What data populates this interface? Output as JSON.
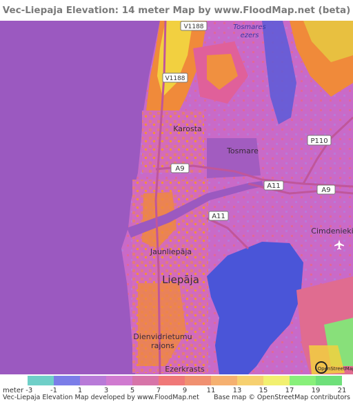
{
  "title": "Vec-Liepaja Elevation: 14 meter Map by www.FloodMap.net (beta)",
  "map": {
    "place_labels": {
      "karosta": "Karosta",
      "tosmare": "Tosmare",
      "tosmares_ezers_line1": "Tosmares",
      "tosmares_ezers_line2": "ezers",
      "jaunliepaja": "Jaunliepāja",
      "liepaja": "Liepāja",
      "cimdenieki": "Cimdenieki",
      "dienvidrietumu_line1": "Dienvidrietumu",
      "dienvidrietumu_line2": "rajons",
      "ezerkrasts": "Ezerkrasts"
    },
    "road_shields": {
      "v1188_top": "V1188",
      "v1188_mid": "V1188",
      "p110": "P110",
      "a9_west": "A9",
      "a11_mid": "A11",
      "a9_east": "A9",
      "a11_south": "A11"
    },
    "osm_badge": "OpenStreetMap",
    "airport_icon": "airplane-icon",
    "colors": {
      "sea": "#9b59c0",
      "lake": "#4a55d8",
      "land_low": "#d070c8",
      "land_mid": "#e0609a",
      "land_high": "#f08a3a",
      "land_peak": "#f2d040",
      "road": "#c0569a"
    }
  },
  "legend": {
    "unit_label": "meter",
    "ticks": [
      "-3",
      "-1",
      "1",
      "3",
      "5",
      "7",
      "9",
      "11",
      "13",
      "15",
      "17",
      "19",
      "21"
    ],
    "colors": [
      "#6fcfc8",
      "#7b7de8",
      "#b87ad8",
      "#d07ad0",
      "#d774a8",
      "#f07878",
      "#f09070",
      "#f5b070",
      "#f6d070",
      "#f2f070",
      "#88f07a",
      "#6ee07a"
    ]
  },
  "footer": {
    "left": "Vec-Liepaja Elevation Map developed by www.FloodMap.net",
    "right": "Base map © OpenStreetMap contributors"
  }
}
